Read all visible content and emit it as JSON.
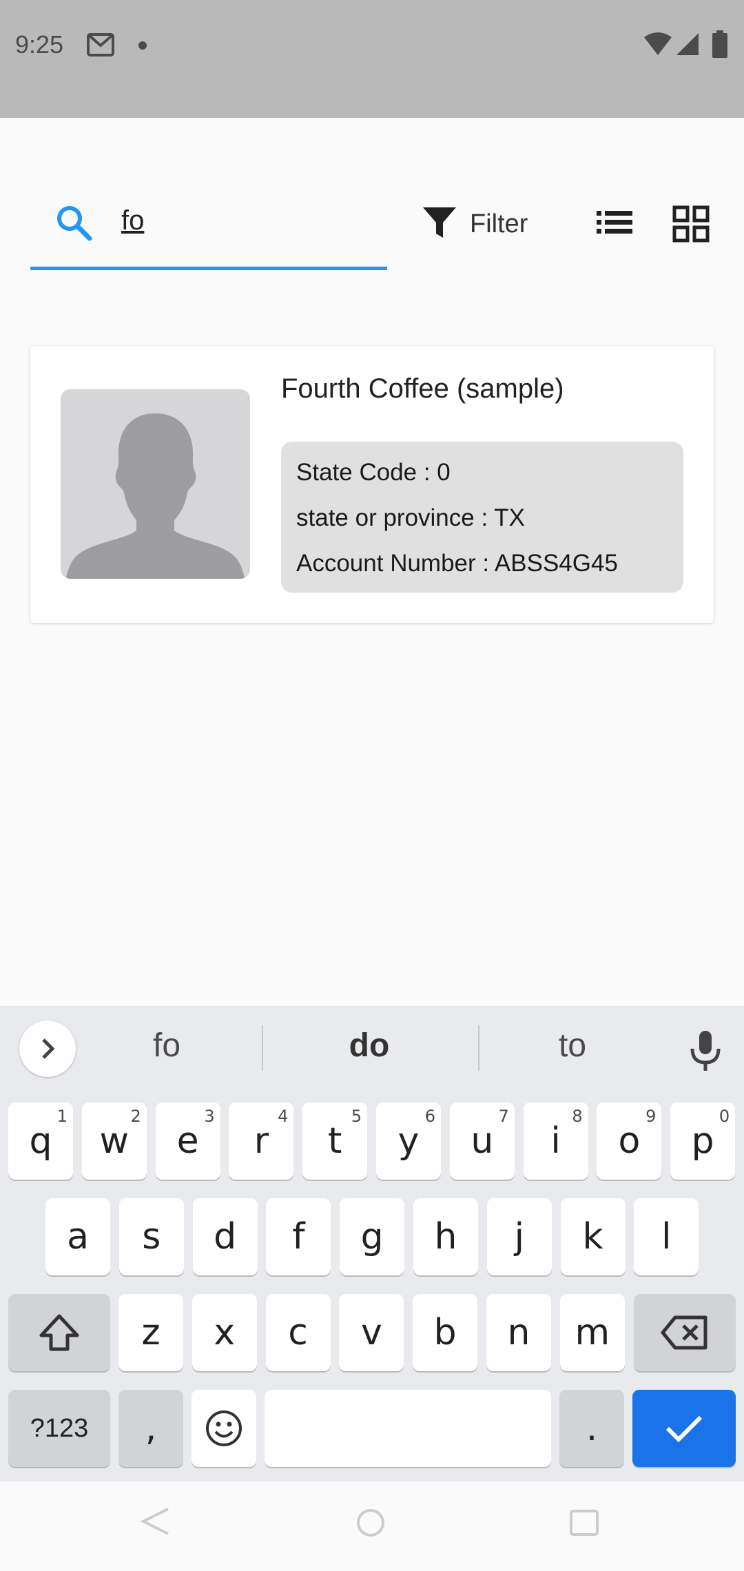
{
  "status_bar": {
    "time": "9:25"
  },
  "search": {
    "value": "fo"
  },
  "toolbar": {
    "filter_label": "Filter"
  },
  "card": {
    "title": "Fourth Coffee (sample)",
    "details": [
      "State Code : 0",
      "state or province : TX",
      "Account Number : ABSS4G45"
    ]
  },
  "keyboard": {
    "suggestions": [
      "fo",
      "do",
      "to"
    ],
    "row1": [
      {
        "key": "q",
        "hint": "1"
      },
      {
        "key": "w",
        "hint": "2"
      },
      {
        "key": "e",
        "hint": "3"
      },
      {
        "key": "r",
        "hint": "4"
      },
      {
        "key": "t",
        "hint": "5"
      },
      {
        "key": "y",
        "hint": "6"
      },
      {
        "key": "u",
        "hint": "7"
      },
      {
        "key": "i",
        "hint": "8"
      },
      {
        "key": "o",
        "hint": "9"
      },
      {
        "key": "p",
        "hint": "0"
      }
    ],
    "row2": [
      "a",
      "s",
      "d",
      "f",
      "g",
      "h",
      "j",
      "k",
      "l"
    ],
    "row3": [
      "z",
      "x",
      "c",
      "v",
      "b",
      "n",
      "m"
    ],
    "symbols_label": "?123",
    "comma": ",",
    "period": ".",
    "accent_color": "#1a73e8"
  }
}
